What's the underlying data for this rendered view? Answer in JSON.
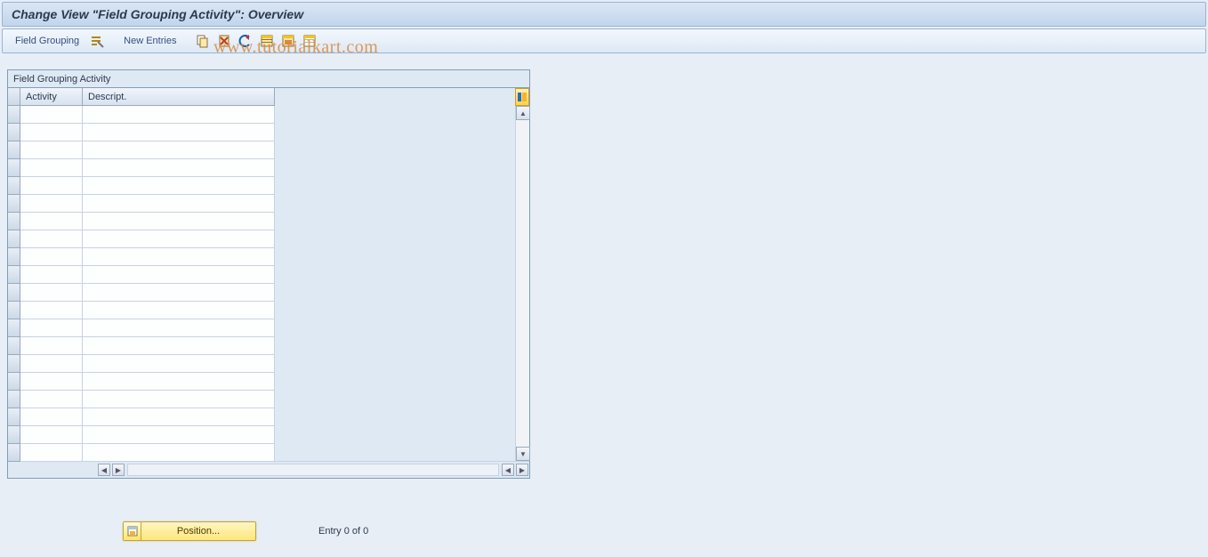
{
  "title": "Change View \"Field Grouping Activity\": Overview",
  "toolbar": {
    "field_grouping": "Field Grouping",
    "new_entries": "New Entries",
    "icons": {
      "details": "details-icon",
      "copy": "copy-icon",
      "delete": "delete-icon",
      "undo": "undo-icon",
      "select_all": "select-all-icon",
      "select_block": "select-block-icon",
      "deselect_all": "deselect-all-icon"
    }
  },
  "table": {
    "title": "Field Grouping Activity",
    "columns": {
      "activity": "Activity",
      "descript": "Descript."
    },
    "rows": [
      {
        "activity": "",
        "descript": ""
      },
      {
        "activity": "",
        "descript": ""
      },
      {
        "activity": "",
        "descript": ""
      },
      {
        "activity": "",
        "descript": ""
      },
      {
        "activity": "",
        "descript": ""
      },
      {
        "activity": "",
        "descript": ""
      },
      {
        "activity": "",
        "descript": ""
      },
      {
        "activity": "",
        "descript": ""
      },
      {
        "activity": "",
        "descript": ""
      },
      {
        "activity": "",
        "descript": ""
      },
      {
        "activity": "",
        "descript": ""
      },
      {
        "activity": "",
        "descript": ""
      },
      {
        "activity": "",
        "descript": ""
      },
      {
        "activity": "",
        "descript": ""
      },
      {
        "activity": "",
        "descript": ""
      },
      {
        "activity": "",
        "descript": ""
      },
      {
        "activity": "",
        "descript": ""
      },
      {
        "activity": "",
        "descript": ""
      },
      {
        "activity": "",
        "descript": ""
      },
      {
        "activity": "",
        "descript": ""
      }
    ],
    "config_icon": "table-settings-icon"
  },
  "footer": {
    "position_label": "Position...",
    "entry_text": "Entry 0 of 0"
  },
  "watermark": "www.tutorialkart.com"
}
